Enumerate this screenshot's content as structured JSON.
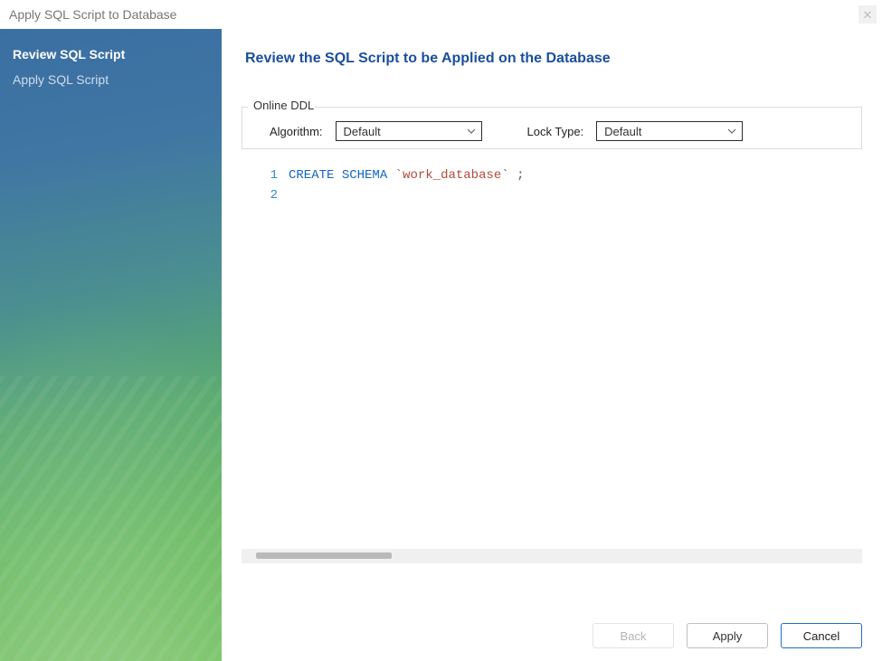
{
  "window": {
    "title": "Apply SQL Script to Database"
  },
  "sidebar": {
    "steps": [
      {
        "label": "Review SQL Script",
        "active": true
      },
      {
        "label": "Apply SQL Script",
        "active": false
      }
    ]
  },
  "main": {
    "heading": "Review the SQL Script to be Applied on the Database",
    "online_ddl": {
      "legend": "Online DDL",
      "algorithm_label": "Algorithm:",
      "algorithm_value": "Default",
      "lock_label": "Lock Type:",
      "lock_value": "Default"
    },
    "editor": {
      "lines": [
        {
          "n": "1"
        },
        {
          "n": "2"
        }
      ],
      "tokens": {
        "kw1": "CREATE",
        "kw2": "SCHEMA",
        "bt_open": "`",
        "ident": "work_database",
        "bt_close": "`",
        "semi": ";"
      }
    }
  },
  "footer": {
    "back": "Back",
    "apply": "Apply",
    "cancel": "Cancel"
  }
}
